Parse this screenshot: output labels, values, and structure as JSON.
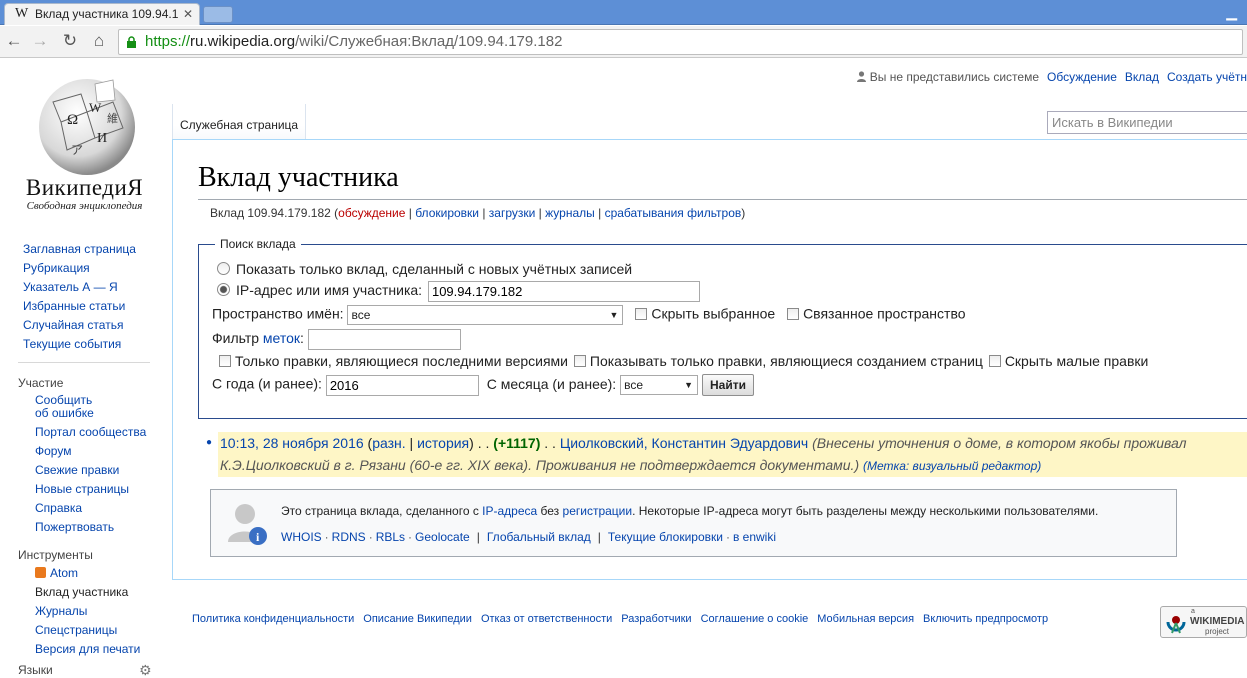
{
  "browser": {
    "tab_title": "Вклад участника 109.94.1",
    "tab_favicon": "W",
    "url_scheme": "https://",
    "url_host": "ru.wikipedia.org",
    "url_path": "/wiki/Служебная:Вклад/109.94.179.182"
  },
  "personal": {
    "anon_text": "Вы не представились системе",
    "talk": "Обсуждение",
    "contribs": "Вклад",
    "create": "Создать учётн"
  },
  "logo": {
    "wordmark": "ВикипедиЯ",
    "tagline": "Свободная энциклопедия"
  },
  "sidebar": {
    "main": [
      "Заглавная страница",
      "Рубрикация",
      "Указатель А — Я",
      "Избранные статьи",
      "Случайная статья",
      "Текущие события"
    ],
    "participation_heading": "Участие",
    "participation": [
      "Сообщить\nоб ошибке",
      "Портал сообщества",
      "Форум",
      "Свежие правки",
      "Новые страницы",
      "Справка",
      "Пожертвовать"
    ],
    "tools_heading": "Инструменты",
    "tools": [
      "Atom",
      "Вклад участника",
      "Журналы",
      "Спецстраницы",
      "Версия для печати"
    ],
    "languages_heading": "Языки"
  },
  "ns_tab": "Служебная страница",
  "search_placeholder": "Искать в Википедии",
  "page": {
    "title": "Вклад участника",
    "subnav_prefix": "Вклад 109.94.179.182 (",
    "subnav_talk": "обсуждение",
    "subnav_blocks": "блокировки",
    "subnav_uploads": "загрузки",
    "subnav_logs": "журналы",
    "subnav_filter": "срабатывания фильтров",
    "subnav_suffix": ")"
  },
  "form": {
    "legend": "Поиск вклада",
    "radio_new": "Показать только вклад, сделанный с новых учётных записей",
    "radio_ip": "IP-адрес или имя участника:",
    "ip_value": "109.94.179.182",
    "ns_label": "Пространство имён:",
    "ns_value": "все",
    "hide_selected": "Скрыть выбранное",
    "associated": "Связанное пространство",
    "tag_filter_prefix": "Фильтр ",
    "tag_filter_link": "меток",
    "tag_filter_suffix": ":",
    "only_latest": "Только правки, являющиеся последними версиями",
    "only_new_pages": "Показывать только правки, являющиеся созданием страниц",
    "hide_minor": "Скрыть малые правки",
    "year_label": "С года (и ранее):",
    "year_value": "2016",
    "month_label": "С месяца (и ранее):",
    "month_value": "все",
    "submit": "Найти"
  },
  "contribution": {
    "timestamp": "10:13, 28 ноября 2016",
    "diff": "разн.",
    "history": "история",
    "size_change": "(+1117)",
    "article": "Циолковский, Константин Эдуардович",
    "comment": "(Внесены уточнения о доме, в котором якобы проживал К.Э.Циолковский в г. Рязани (60-е гг. XIX века). Проживания не подтверждается документами.)",
    "tag": "(Метка: визуальный редактор)"
  },
  "ipbox": {
    "t1": "Это страница вклада, сделанного с ",
    "t2": "IP-адреса",
    "t3": " без ",
    "t4": "регистрации",
    "t5": ". Некоторые IP-адреса могут быть разделены между несколькими пользователями.",
    "whois": "WHOIS",
    "rdns": "RDNS",
    "rbls": "RBLs",
    "geolocate": "Geolocate",
    "global": "Глобальный вклад",
    "blocks": "Текущие блокировки",
    "enwiki": "в enwiki"
  },
  "footer": [
    "Политика конфиденциальности",
    "Описание Википедии",
    "Отказ от ответственности",
    "Разработчики",
    "Соглашение о cookie",
    "Мобильная версия",
    "Включить предпросмотр"
  ],
  "wikimedia_badge": {
    "top": "a",
    "name": "WIKIMEDIA",
    "sub": "project"
  }
}
